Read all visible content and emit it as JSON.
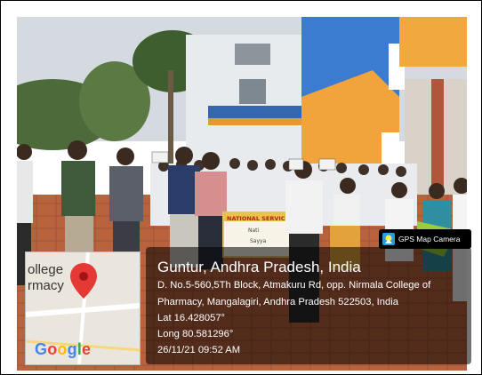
{
  "map": {
    "text_line1": "ollege",
    "text_line2": "rmacy",
    "logo_text": "Google",
    "logo_colors": [
      "#4285F4",
      "#EA4335",
      "#FBBC05",
      "#4285F4",
      "#34A853",
      "#EA4335"
    ],
    "pin_color": "#e53935",
    "pin_icon": "location-pin-icon"
  },
  "gps": {
    "title": "Guntur, Andhra Pradesh, India",
    "address_line1": "D. No.5-560,5Th Block, Atmakuru Rd, opp. Nirmala College of",
    "address_line2": "Pharmacy, Mangalagiri, Andhra Pradesh 522503, India",
    "lat": "Lat 16.428057°",
    "long": "Long 80.581296°",
    "datetime": "26/11/21 09:52 AM"
  },
  "badge": {
    "label": "GPS Map Camera",
    "icon": "gps-camera-icon"
  },
  "banner": {
    "line1": "NATIONAL SERVICE",
    "line2": "Nati",
    "line3": "Sayya"
  },
  "colors": {
    "sky": "#cfd6dc",
    "building_blue": "#3a78c8",
    "building_orange": "#f2a23a",
    "ground": "#b9653f",
    "overlay": "rgba(0,0,0,0.55)"
  }
}
